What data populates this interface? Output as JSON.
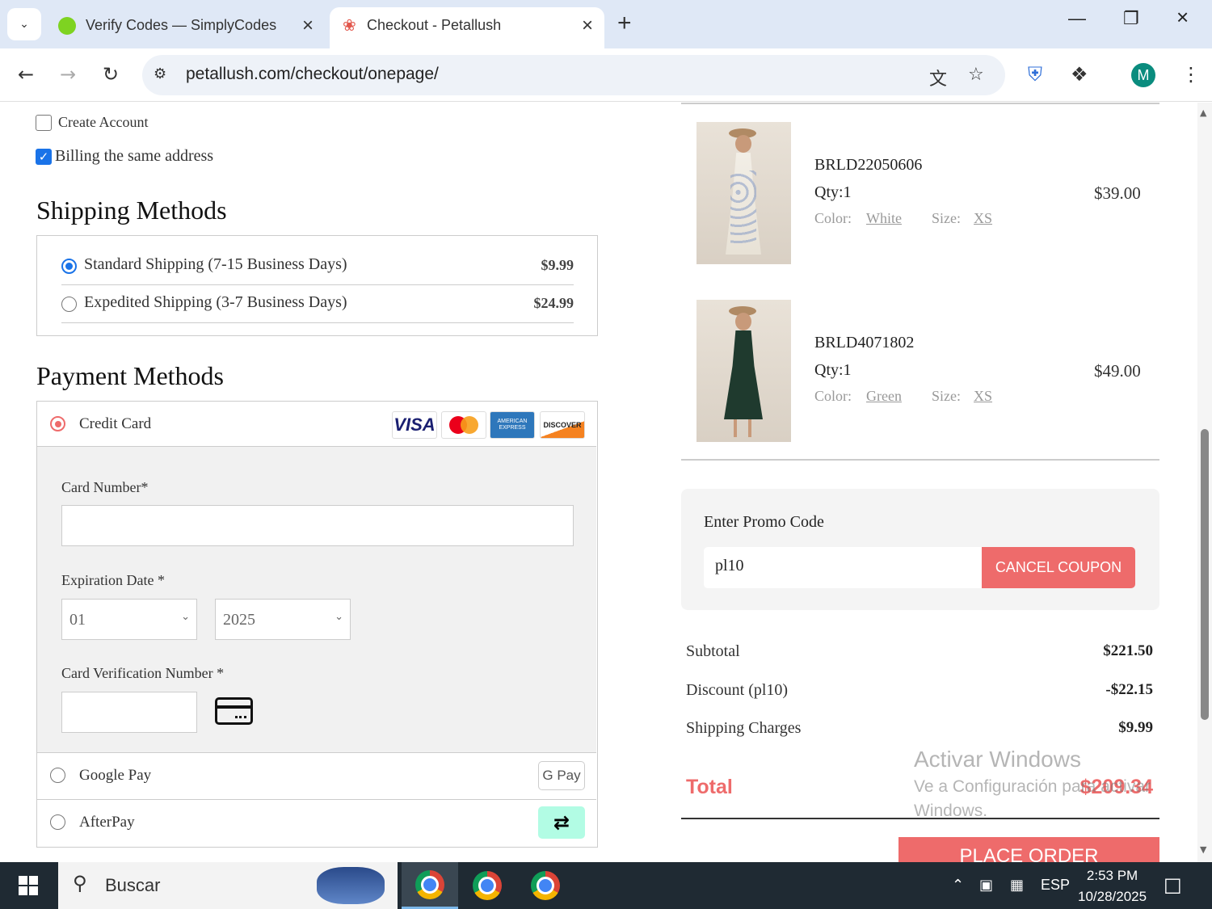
{
  "browser": {
    "tabs": [
      {
        "title": "Verify Codes — SimplyCodes",
        "active": false
      },
      {
        "title": "Checkout - Petallush",
        "active": true
      }
    ],
    "url": "petallush.com/checkout/onepage/",
    "profile_initial": "M"
  },
  "form": {
    "create_account_label": "Create Account",
    "create_account_checked": false,
    "billing_same_label": "Billing the same address",
    "billing_same_checked": true
  },
  "shipping": {
    "heading": "Shipping Methods",
    "options": [
      {
        "label": "Standard Shipping (7-15 Business Days)",
        "price": "$9.99",
        "selected": true
      },
      {
        "label": "Expedited Shipping (3-7 Business Days)",
        "price": "$24.99",
        "selected": false
      }
    ]
  },
  "payment": {
    "heading": "Payment Methods",
    "credit_card_label": "Credit Card",
    "card_logos": [
      "VISA",
      "mastercard",
      "AMERICAN EXPRESS",
      "DISCOVER"
    ],
    "card_number_label": "Card Number*",
    "card_number_value": "",
    "expiration_label": "Expiration Date *",
    "exp_month": "01",
    "exp_year": "2025",
    "cvv_label": "Card Verification Number *",
    "cvv_value": "",
    "google_pay_label": "Google Pay",
    "google_pay_badge": "G Pay",
    "afterpay_label": "AfterPay"
  },
  "cart": {
    "items": [
      {
        "sku": "BRLD22050606",
        "qty": "Qty:1",
        "color_label": "Color:",
        "color": "White",
        "size_label": "Size:",
        "size": "XS",
        "price": "$39.00"
      },
      {
        "sku": "BRLD4071802",
        "qty": "Qty:1",
        "color_label": "Color:",
        "color": "Green",
        "size_label": "Size:",
        "size": "XS",
        "price": "$49.00"
      }
    ]
  },
  "promo": {
    "title": "Enter Promo Code",
    "value": "pl10",
    "button": "CANCEL COUPON"
  },
  "summary": {
    "subtotal_label": "Subtotal",
    "subtotal": "$221.50",
    "discount_label": "Discount (pl10)",
    "discount": "-$22.15",
    "shipping_label": "Shipping Charges",
    "shipping": "$9.99",
    "total_label": "Total",
    "total": "$209.34",
    "place_order": "PLACE ORDER"
  },
  "watermark": {
    "line1": "Activar Windows",
    "line2": "Ve a Configuración para activar",
    "line3": "Windows."
  },
  "taskbar": {
    "search_placeholder": "Buscar",
    "language": "ESP",
    "time": "2:53 PM",
    "date": "10/28/2025"
  },
  "colors": {
    "accent": "#ee6b6b",
    "link_blue": "#1a73e8"
  }
}
